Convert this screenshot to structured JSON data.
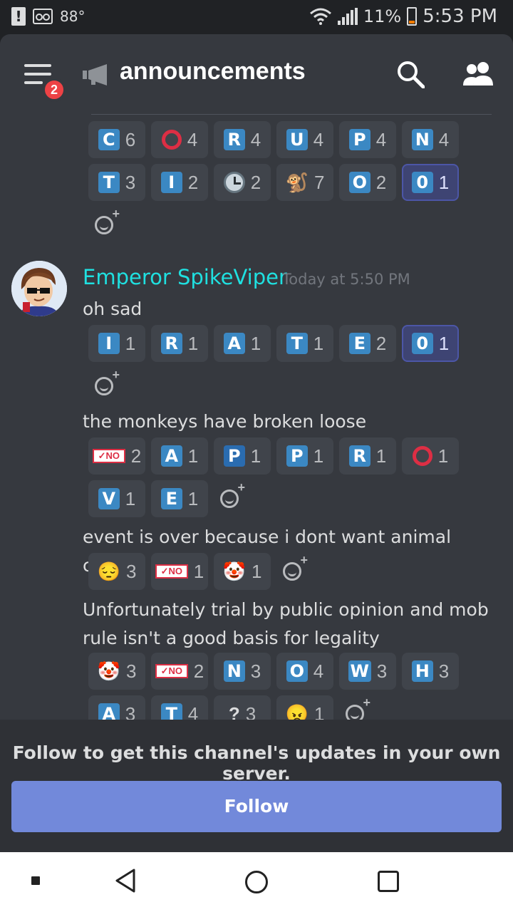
{
  "status_bar": {
    "temperature": "88°",
    "battery": "11%",
    "time": "5:53 PM"
  },
  "header": {
    "badge_count": "2",
    "channel_name": "announcements"
  },
  "reactions_prev_row1": [
    {
      "label": "C",
      "count": "6"
    },
    {
      "label": "ring",
      "count": "4"
    },
    {
      "label": "R",
      "count": "4"
    },
    {
      "label": "U",
      "count": "4"
    },
    {
      "label": "P",
      "count": "4"
    },
    {
      "label": "N",
      "count": "4"
    }
  ],
  "reactions_prev_row2": [
    {
      "label": "T",
      "count": "3"
    },
    {
      "label": "I",
      "count": "2"
    },
    {
      "label": "clock",
      "count": "2"
    },
    {
      "label": "monkey",
      "count": "7"
    },
    {
      "label": "O",
      "count": "2"
    },
    {
      "label": "0",
      "count": "1"
    }
  ],
  "message": {
    "author": "Emperor SpikeViper",
    "timestamp": "Today at 5:50 PM",
    "lines": [
      "oh sad",
      "the monkeys have broken loose",
      "event is over because i dont want animal control",
      "Unfortunately trial by public opinion and mob rule isn't a good basis for legality"
    ]
  },
  "reactions_msg1": [
    {
      "label": "I",
      "count": "1"
    },
    {
      "label": "R",
      "count": "1"
    },
    {
      "label": "A",
      "count": "1"
    },
    {
      "label": "T",
      "count": "1"
    },
    {
      "label": "E",
      "count": "2"
    },
    {
      "label": "0",
      "count": "1"
    }
  ],
  "reactions_msg2": [
    {
      "label": "NO",
      "count": "2"
    },
    {
      "label": "A",
      "count": "1"
    },
    {
      "label": "P",
      "count": "1"
    },
    {
      "label": "P",
      "count": "1"
    },
    {
      "label": "R",
      "count": "1"
    },
    {
      "label": "ring",
      "count": "1"
    },
    {
      "label": "V",
      "count": "1"
    },
    {
      "label": "E",
      "count": "1"
    }
  ],
  "reactions_msg3": [
    {
      "label": "pensive",
      "count": "3"
    },
    {
      "label": "NO",
      "count": "1"
    },
    {
      "label": "clown",
      "count": "1"
    }
  ],
  "reactions_msg4": [
    {
      "label": "clown",
      "count": "3"
    },
    {
      "label": "NO",
      "count": "2"
    },
    {
      "label": "N",
      "count": "3"
    },
    {
      "label": "O",
      "count": "4"
    },
    {
      "label": "W",
      "count": "3"
    },
    {
      "label": "H",
      "count": "3"
    },
    {
      "label": "A",
      "count": "3"
    },
    {
      "label": "T",
      "count": "4"
    },
    {
      "label": "?",
      "count": "3"
    },
    {
      "label": "angry",
      "count": "1"
    }
  ],
  "follow": {
    "prompt": "Follow to get this channel's updates in your own server.",
    "button_label": "Follow"
  },
  "colors": {
    "username": "#1fe0e0",
    "follow_button": "#7289da",
    "badge": "#ed4245"
  }
}
